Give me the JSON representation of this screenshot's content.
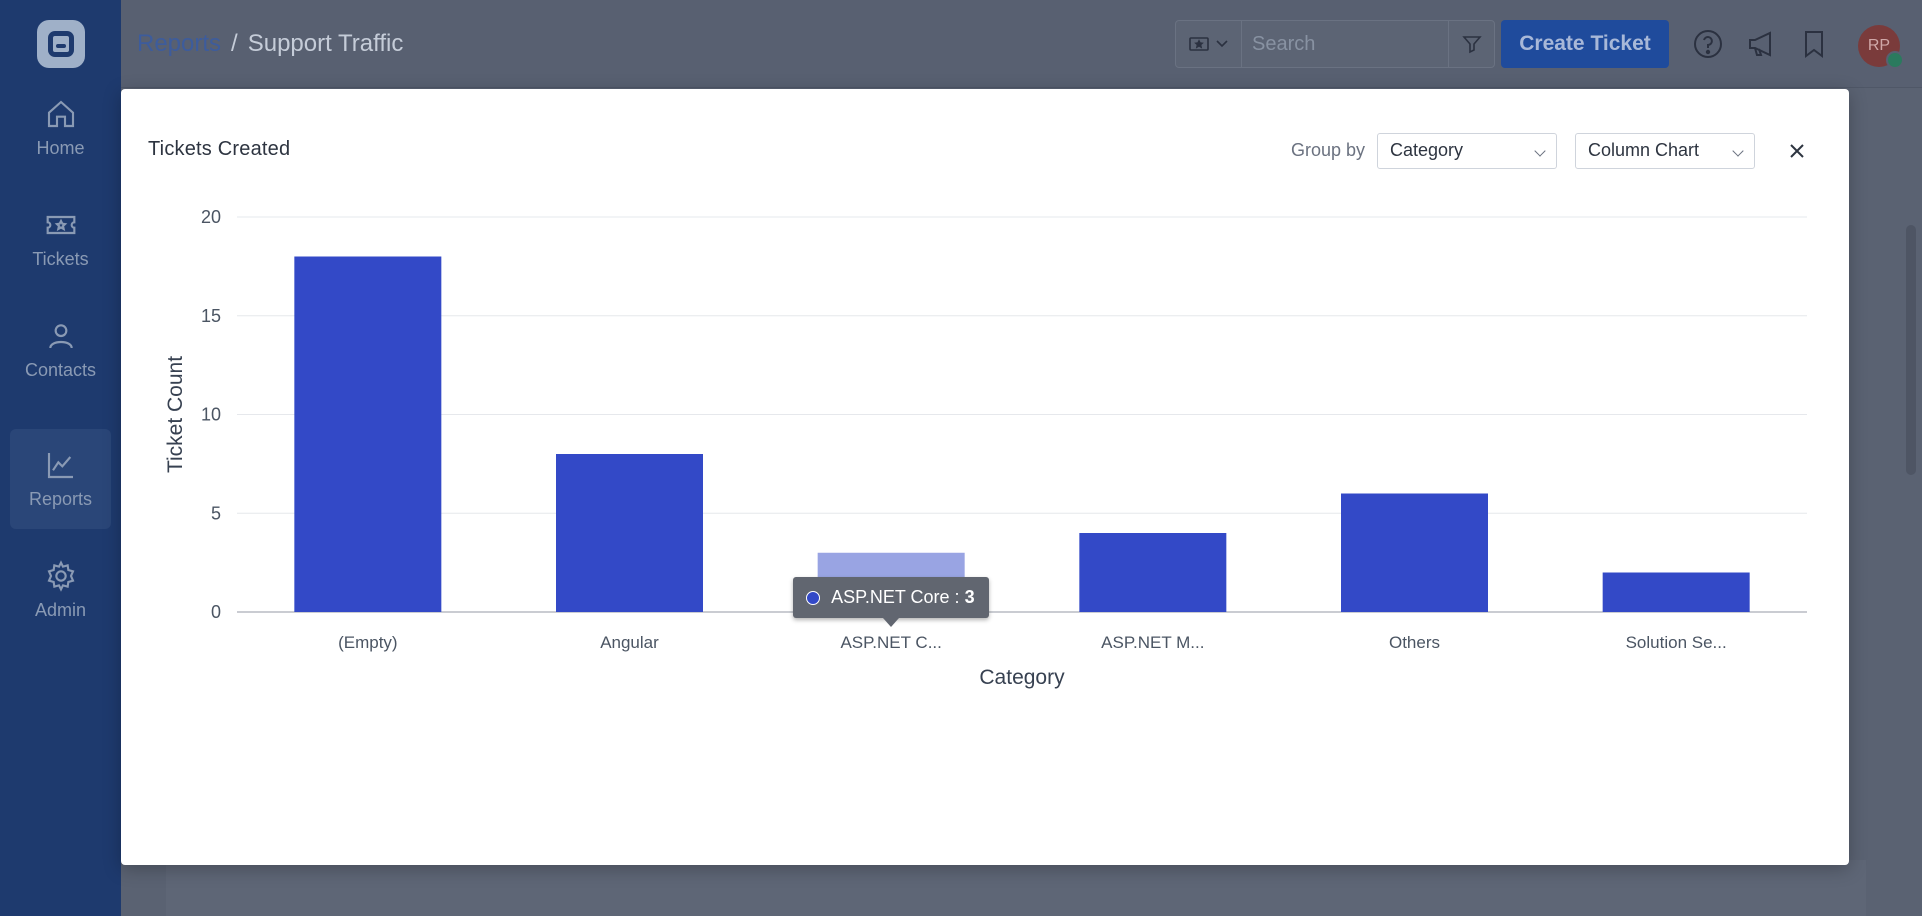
{
  "sidebar": {
    "items": [
      {
        "label": "Home",
        "icon": "home-icon"
      },
      {
        "label": "Tickets",
        "icon": "ticket-icon"
      },
      {
        "label": "Contacts",
        "icon": "user-icon"
      },
      {
        "label": "Reports",
        "icon": "chart-icon"
      },
      {
        "label": "Admin",
        "icon": "gear-icon"
      }
    ],
    "active": "Reports"
  },
  "header": {
    "breadcrumb_link": "Reports",
    "breadcrumb_sep": "/",
    "breadcrumb_current": "Support Traffic",
    "search_placeholder": "Search",
    "create_label": "Create Ticket",
    "avatar_initials": "RP"
  },
  "modal": {
    "title": "Tickets Created",
    "group_by_label": "Group by",
    "group_by_value": "Category",
    "chart_type_value": "Column Chart"
  },
  "chart_data": {
    "type": "bar",
    "categories": [
      "(Empty)",
      "Angular",
      "ASP.NET C...",
      "ASP.NET M...",
      "Others",
      "Solution Se..."
    ],
    "values": [
      18,
      8,
      3,
      4,
      6,
      2
    ],
    "xlabel": "Category",
    "ylabel": "Ticket Count",
    "ylim": [
      0,
      20
    ],
    "yticks": [
      0,
      5,
      10,
      15,
      20
    ],
    "highlight_index": 2,
    "bar_color": "#3349c7",
    "highlight_color": "#99a4e3",
    "tooltip": {
      "label": "ASP.NET Core",
      "value": "3"
    }
  },
  "colors": {
    "sidebar": "#1e3a6e",
    "accent": "#1f4b9c"
  }
}
